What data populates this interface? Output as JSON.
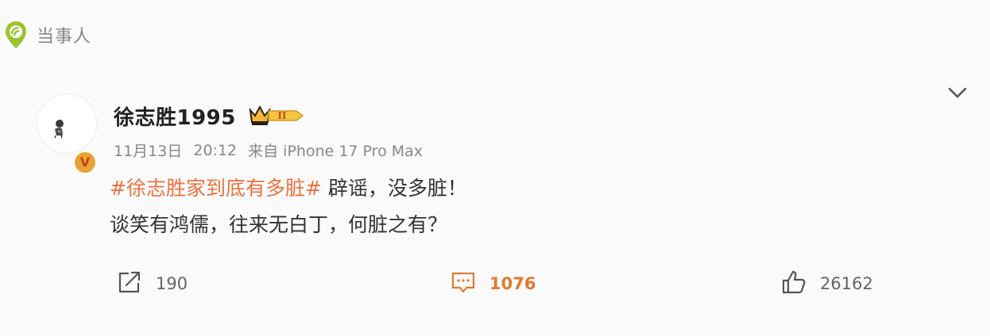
{
  "header": {
    "source_icon": "location-ring-icon",
    "source_label": "当事人",
    "more_icon": "chevron-down-icon"
  },
  "post": {
    "author": "徐志胜1995",
    "verified_mark": "V",
    "vip_level": "II",
    "date": "11月13日",
    "time": "20:12",
    "device": "来自 iPhone 17 Pro Max",
    "topic": "#徐志胜家到底有多脏#",
    "line1_rest": " 辟谣，没多脏！",
    "line2": "谈笑有鸿儒，往来无白丁，何脏之有？"
  },
  "actions": {
    "repost_count": "190",
    "comment_count": "1076",
    "like_count": "26162"
  },
  "colors": {
    "accent_topic": "#eb7340",
    "comment_accent": "#e07a2e",
    "source_icon": "#9bc42d",
    "badge_orange": "#e8a234"
  }
}
